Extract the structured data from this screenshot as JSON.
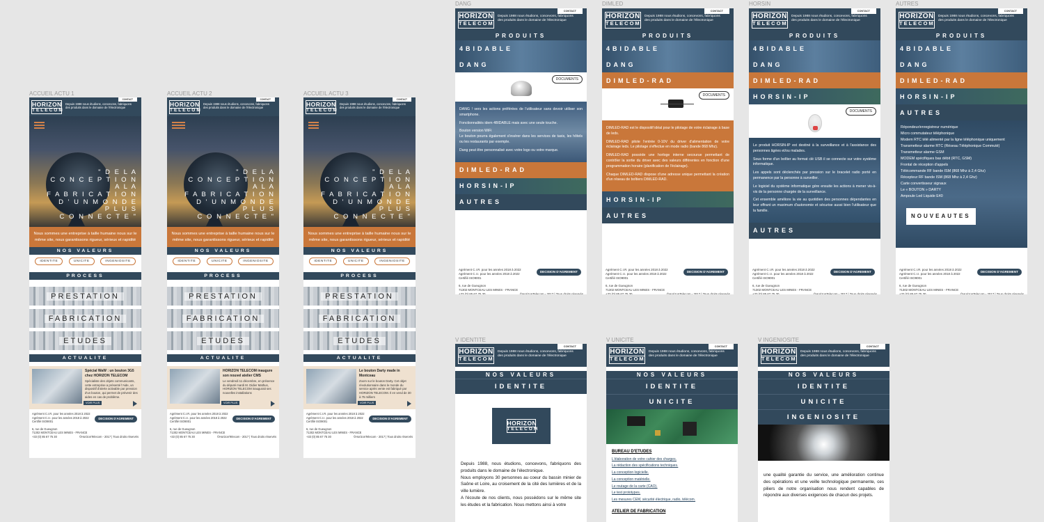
{
  "labels": {
    "accueil1": "ACCUEIL ACTU 1",
    "accueil2": "ACCUEIL ACTU 2",
    "accueil3": "ACCUEIL ACTU 3",
    "dang": "DANG",
    "dimled": "DIMLED",
    "horsin": "HORSIN",
    "autres": "AUTRES",
    "videntite": "V IDENTITE",
    "vunicite": "V UNICITE",
    "vingeniosite": "V INGENIOSITE"
  },
  "header": {
    "logo_top": "HORIZON",
    "logo_bottom": "TELECOM",
    "tagline": "Depuis 1988 nous étudions, concevons, fabriquons des produits dans le domaine de l'électronique",
    "contact": "CONTACT"
  },
  "home": {
    "quote": "\" D E  L A\nC O N C E P T I O N\nA  L A\nF A B R I C A T I O N\nD ' U N  M O N D E\nP L U S\nC O N N E C T E \"",
    "intro": "Nous sommes une entreprise à taille humaine nous sur le même site, nous garantissons rigueur, sérieux et rapidité",
    "valeurs_title": "NOS VALEURS",
    "pills": [
      "IDENTITE",
      "UNICITE",
      "INGENIOSITE"
    ],
    "process_title": "PROCESS",
    "tiles": [
      "PRESTATION",
      "FABRICATION",
      "ETUDES"
    ],
    "actu_title": "ACTUALITE",
    "news": [
      {
        "title": "Spécial WaW : un bouton 3G5 chez HORIZON TELECOM",
        "body": "Spécialiste des objets communicants, cette entreprise a présenté l'Aide, un dispositif d'alerte activable par pression d'un bouton, qui permet de prévenir des aides en cas de problème."
      },
      {
        "title": "HORIZON TELECOM inaugure son nouvel atelier CMS",
        "body": "Le vendredi 11 décembre, en présence du député mardi M. Didier Mathus, HORIZON TELECOM inaugurait ses nouvelles installations"
      },
      {
        "title": "Le bouton Darty made in Montceau",
        "body": "Zoom sur le bouton Darty. Cet objet révolutionnaire dans le monde du service après vente est fabriqué par HORIZON TELECOM. Il en vend de 30 à 75 milliers"
      }
    ],
    "voir_plus": "VOIR PLUS"
  },
  "footer": {
    "agrement1": "Agrément C.I.R. pour les années 2018 à 2022",
    "agrement2": "Agrément C.I.I. pour les années 2018 à 2022",
    "certif": "Certifié ISO9001",
    "decision": "DECISION D'AGREMENT",
    "addr1": "6, rue de Gueugnon",
    "addr2": "71302 MONTCEAU LES MINES - FRANCE",
    "phone": "+33 (0) 85 67 75 30",
    "copyright": "©HorizonTelecom - 2017 | Tous droits réservés"
  },
  "products": {
    "title": "PRODUITS",
    "items": [
      "4BIDABLE",
      "DANG",
      "DIMLED-RAD",
      "HORSIN-IP",
      "AUTRES"
    ],
    "documents": "DOCUMENTS",
    "dang_desc": [
      "DANG ! vers les actions préférées de l'utilisateur sans devoir utiliser son smartphone.",
      "Fonctionnalités idem 4BIDABLE mais avec une seule touche.",
      "Bouton version WiFi\nLe bouton pourra également s'insérer dans les services de taxis, les hôtels ou les restaurants par exemple.",
      "Dang peut être personnalisé avec votre logo ou votre marque."
    ],
    "dimled_desc": [
      "DIMLED-RAD est le dispositif idéal pour le pilotage de votre éclairage à base de leds.",
      "DIMLED-RAD pilote l'entrée 0-10V du driver d'alimentation de votre éclairage leds. Le pilotage s'effectue en mode radio (bande 868 Mhz).",
      "DIMLED-RAD possède une horloge interne secourue permettant de contrôler la sortie du driver avec des valeurs différentes en fonction d'une programmation horaire (planification de l'éclairage).",
      "Chaque DIMLED-RAD dispose d'une adresse unique permettant la création d'un réseau de boîtiers DIMLED-RAD."
    ],
    "horsin_desc": [
      "Le produit HORSIN-IP est destiné à la surveillance et à l'assistance des personnes âgées et/ou malades.",
      "Sous forme d'un boîtier au format clé USB il se connecte sur votre système informatique.",
      "Les appels sont déclenchés par pression sur le bracelet radio porté en permanence par la personne à surveiller.",
      "Le logiciel du système informatique gère ensuite les actions à mener vis-à-vis de la personne chargée de la surveillance.",
      "Cet ensemble améliore la vie au quotidien des personnes dépendantes en leur offrant un maximum d'autonomie et sécurise aussi bien l'utilisateur que la famille."
    ],
    "autres_list": [
      "Répondeur/enregistreur numérique",
      "Micro commutateur téléphonique",
      "Modem RTC télé alimenté par la ligne téléphonique uniquement",
      "Transmetteur alarme RTC (Réseau Téléphonique Commuté)",
      "Transmetteur alarme GSM",
      "MODEM spécifiques bas débit (RTC, GSM)",
      "Frontal de réception d'appels",
      "Télécommande RF bande ISM (868 Mhz à 2,4 Ghz)",
      "Récepteur RF bande ISM (868 Mhz à 2,4 Ghz)",
      "Carte convertisseur signaux",
      "Le « BOUTON » DARTY",
      "Ampoule Led Liquide E40"
    ],
    "nouveautes": "NOUVEAUTES"
  },
  "valeurs": {
    "title": "NOS VALEURS",
    "identite": "IDENTITE",
    "unicite": "UNICITE",
    "ingeniosite": "INGENIOSITE",
    "identite_text": "Depuis 1988, nous étudions, concevons, fabriquons des produits dans le domaine de l'électronique.\nNous employons 30 personnes au coeur du bassin minier de Saône et Loire, au croisement de la cité des lumières et de la ville lumière.\nA l'écoute de nos clients, nous possédons sur le même site les études et la fabrication. Nous mettons ainsi à votre",
    "bureau_title": "BUREAU D'ETUDES",
    "bureau_items": [
      "L'élaboration de votre cahier des charges.",
      "La rédaction des spécifications techniques.",
      "La conception logicielle.",
      "La conception matérielle.",
      "Le routage de la carte (CAO).",
      "Le test prototypes.",
      "Les mesures CEM, sécurité électrique, radio, télécom."
    ],
    "atelier_title": "ATELIER DE FABRICATION",
    "ingeniosite_text": "une qualité garantie du service, une amélioration continue des opérations et une veille technologique permanente, ces piliers de notre organisation nous rendent capables de répondre aux diverses exigences de chacun des projets."
  },
  "colors": {
    "navy": "#32495c",
    "orange": "#c9773a",
    "background": "#e6e6e6"
  }
}
